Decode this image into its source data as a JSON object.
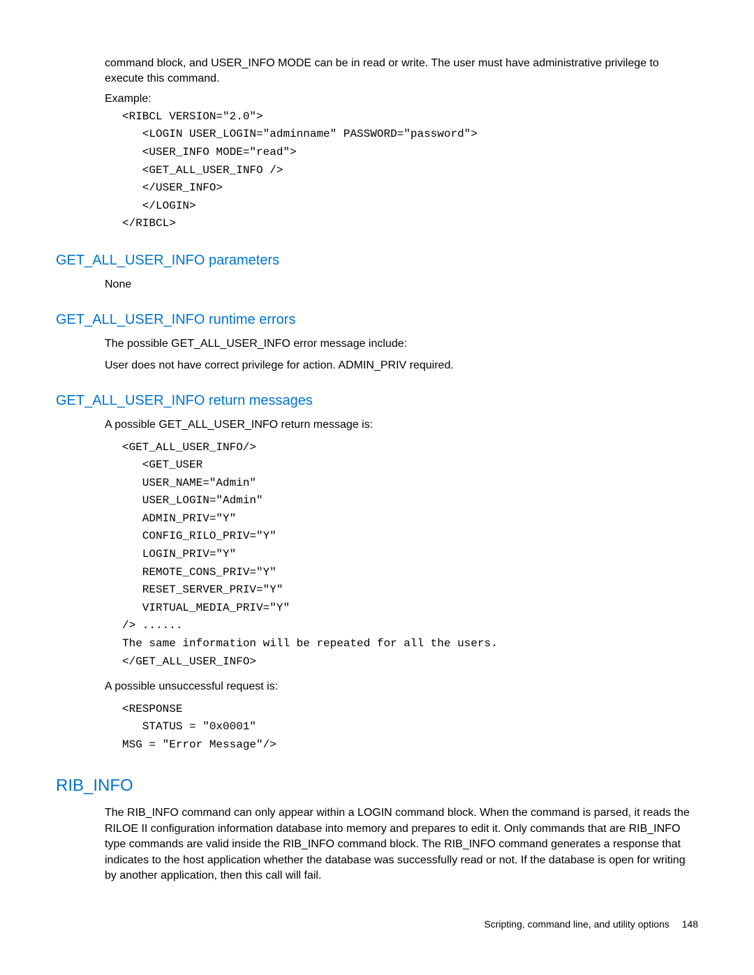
{
  "intro": {
    "p1": "command block, and USER_INFO MODE can be in read or write. The user must have administrative privilege to execute this command.",
    "example_label": "Example:",
    "code": "<RIBCL VERSION=\"2.0\">\n   <LOGIN USER_LOGIN=\"adminname\" PASSWORD=\"password\">\n   <USER_INFO MODE=\"read\">\n   <GET_ALL_USER_INFO />\n   </USER_INFO>\n   </LOGIN>\n</RIBCL>"
  },
  "sec_params": {
    "heading": "GET_ALL_USER_INFO parameters",
    "body": "None"
  },
  "sec_runtime": {
    "heading": "GET_ALL_USER_INFO runtime errors",
    "p1": "The possible GET_ALL_USER_INFO error message include:",
    "p2": "User does not have correct privilege for action. ADMIN_PRIV required."
  },
  "sec_return": {
    "heading": "GET_ALL_USER_INFO return messages",
    "p1": "A possible GET_ALL_USER_INFO return message is:",
    "code1": "<GET_ALL_USER_INFO/>\n   <GET_USER\n   USER_NAME=\"Admin\"\n   USER_LOGIN=\"Admin\"\n   ADMIN_PRIV=\"Y\"\n   CONFIG_RILO_PRIV=\"Y\"\n   LOGIN_PRIV=\"Y\"\n   REMOTE_CONS_PRIV=\"Y\"\n   RESET_SERVER_PRIV=\"Y\"\n   VIRTUAL_MEDIA_PRIV=\"Y\"\n/> ......\nThe same information will be repeated for all the users.\n</GET_ALL_USER_INFO>",
    "p2": "A possible unsuccessful request is:",
    "code2": "<RESPONSE\n   STATUS = \"0x0001\"\nMSG = \"Error Message\"/>"
  },
  "sec_rib": {
    "heading": "RIB_INFO",
    "p1": "The RIB_INFO command can only appear within a LOGIN command block. When the command is parsed, it reads the RILOE II configuration information database into memory and prepares to edit it. Only commands that are RIB_INFO type commands are valid inside the RIB_INFO command block. The RIB_INFO command generates a response that indicates to the host application whether the database was successfully read or not. If the database is open for writing by another application, then this call will fail."
  },
  "footer": {
    "text": "Scripting, command line, and utility options",
    "page": "148"
  }
}
